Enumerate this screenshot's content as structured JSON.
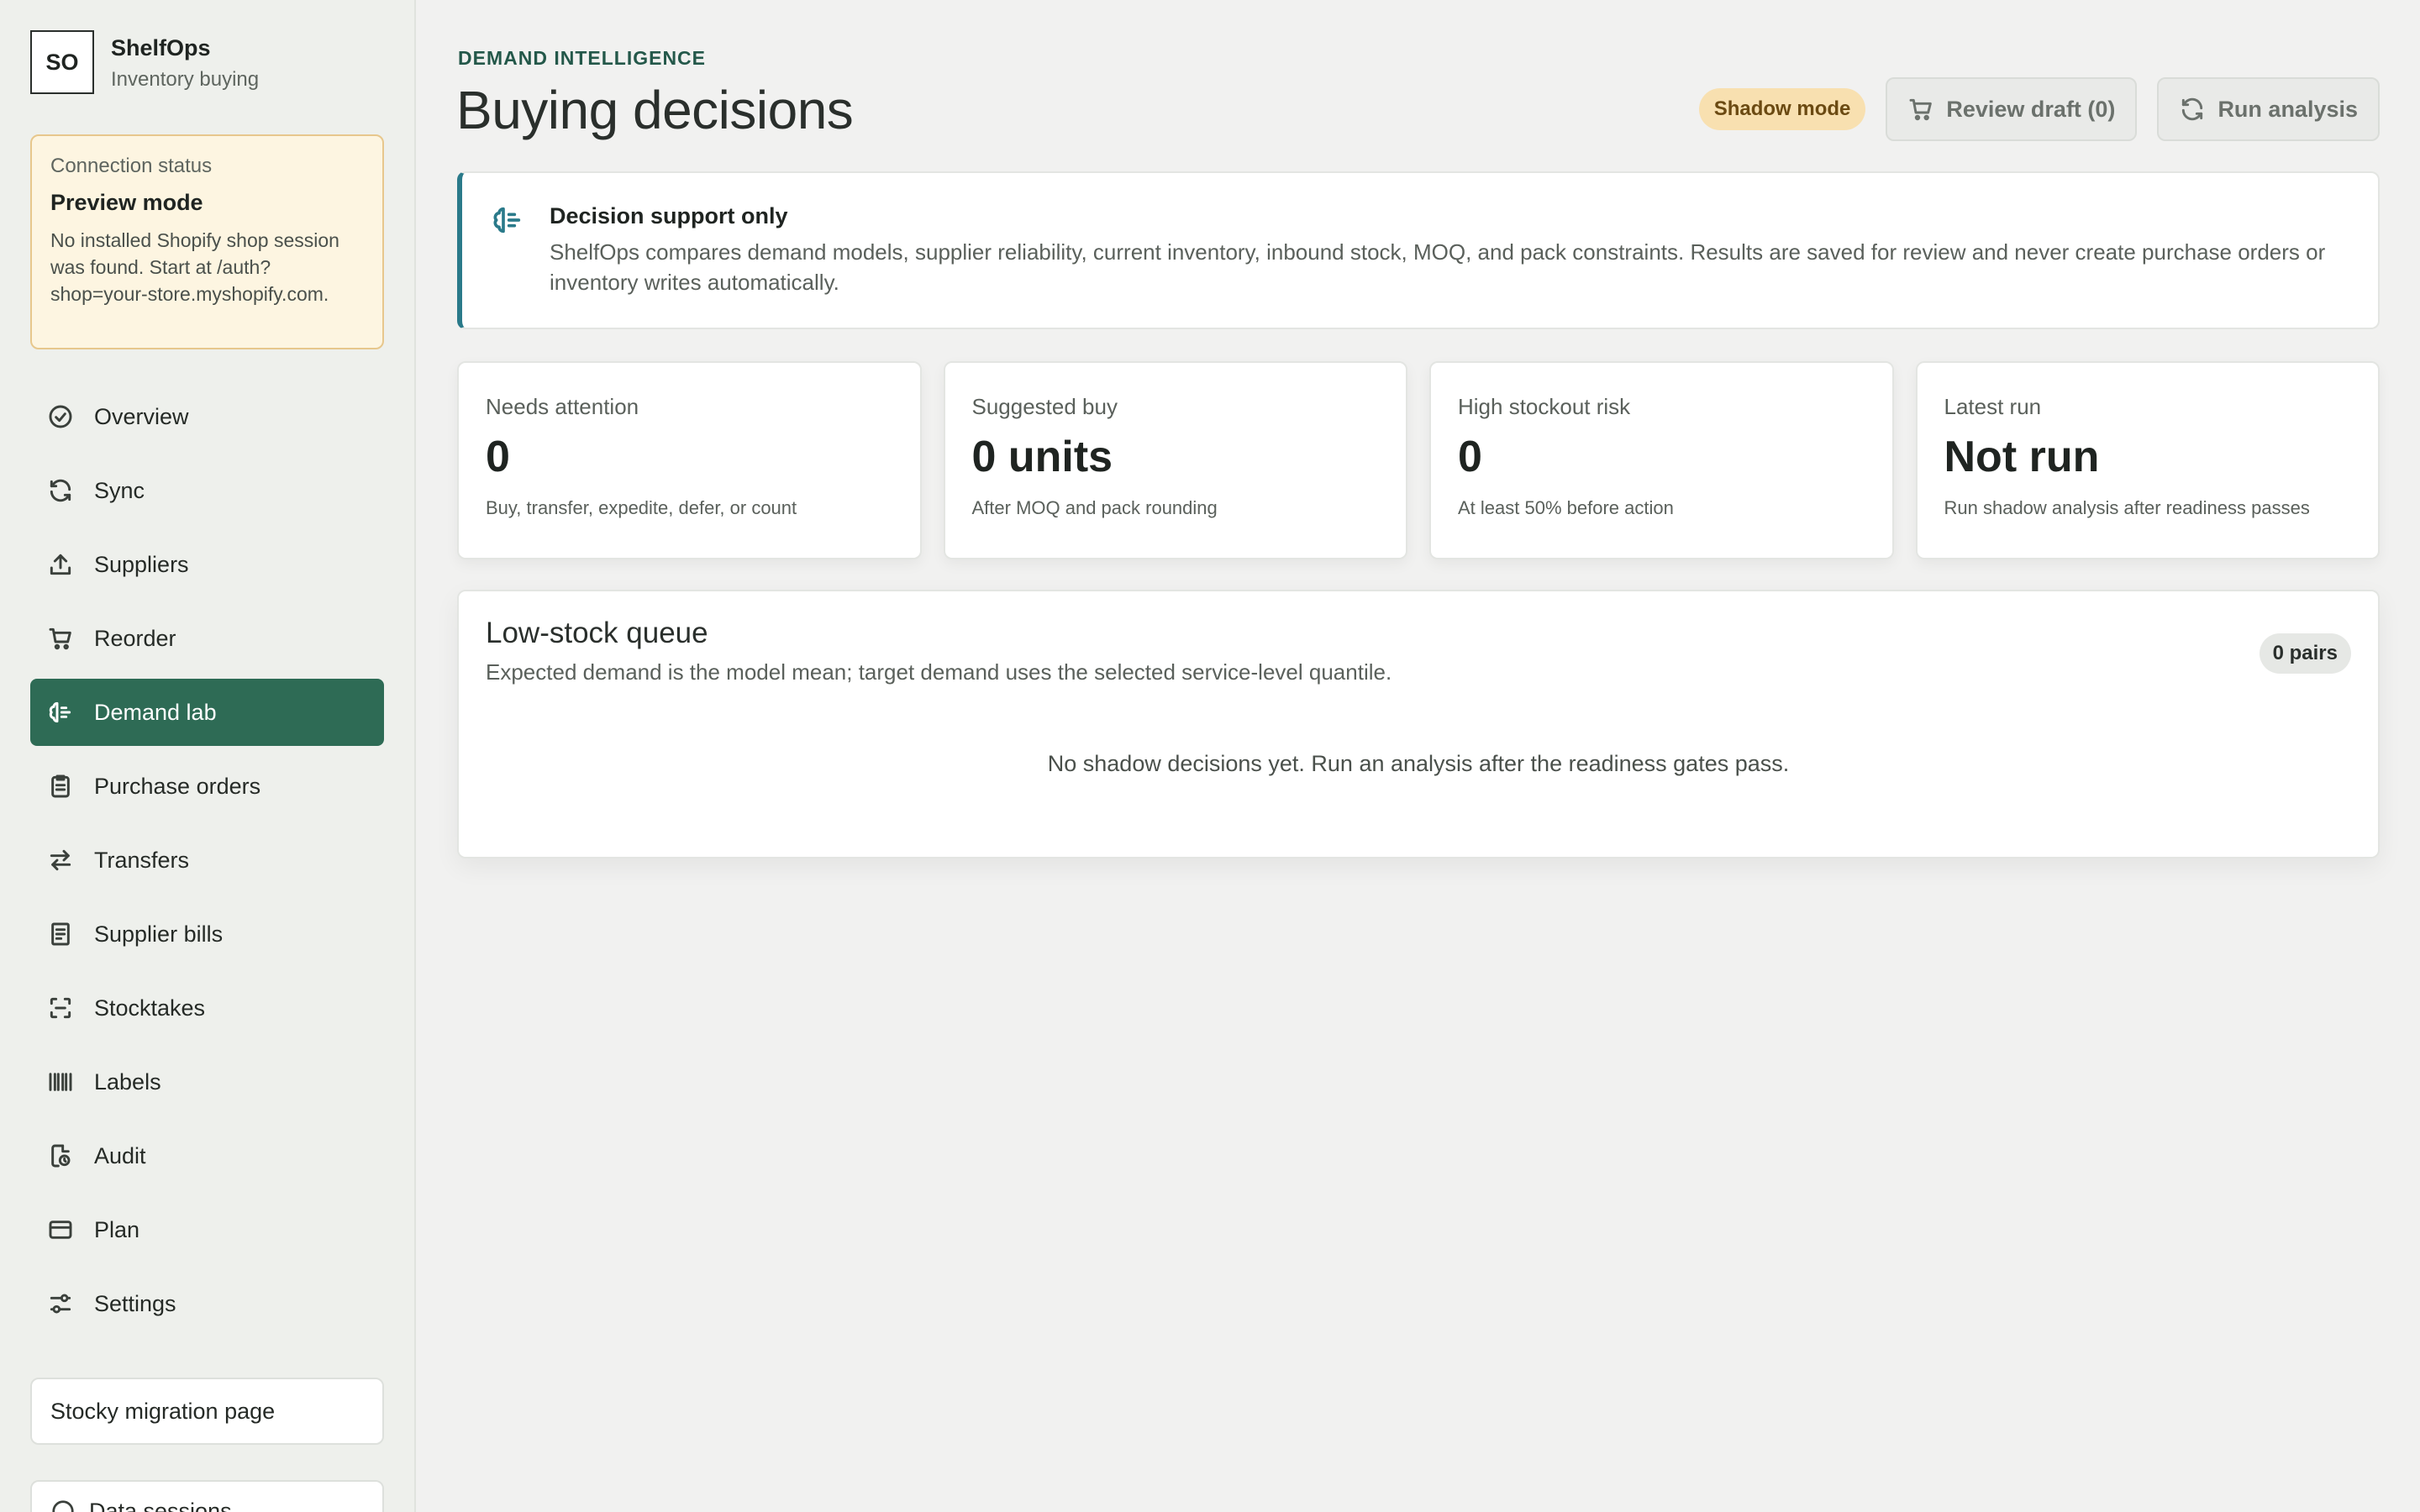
{
  "brand": {
    "logo": "SO",
    "name": "ShelfOps",
    "subtitle": "Inventory buying"
  },
  "connection": {
    "label": "Connection status",
    "title": "Preview mode",
    "body": "No installed Shopify shop session was found. Start at /auth?shop=your-store.myshopify.com."
  },
  "nav": [
    {
      "label": "Overview",
      "icon": "check-circle-icon",
      "active": false
    },
    {
      "label": "Sync",
      "icon": "refresh-icon",
      "active": false
    },
    {
      "label": "Suppliers",
      "icon": "upload-icon",
      "active": false
    },
    {
      "label": "Reorder",
      "icon": "cart-icon",
      "active": false
    },
    {
      "label": "Demand lab",
      "icon": "brain-icon",
      "active": true
    },
    {
      "label": "Purchase orders",
      "icon": "clipboard-icon",
      "active": false
    },
    {
      "label": "Transfers",
      "icon": "arrows-swap-icon",
      "active": false
    },
    {
      "label": "Supplier bills",
      "icon": "receipt-icon",
      "active": false
    },
    {
      "label": "Stocktakes",
      "icon": "scan-icon",
      "active": false
    },
    {
      "label": "Labels",
      "icon": "barcode-icon",
      "active": false
    },
    {
      "label": "Audit",
      "icon": "audit-icon",
      "active": false
    },
    {
      "label": "Plan",
      "icon": "card-icon",
      "active": false
    },
    {
      "label": "Settings",
      "icon": "sliders-icon",
      "active": false
    }
  ],
  "sidebar_footer": {
    "migration_label": "Stocky migration page",
    "next_label": "Data sessions"
  },
  "header": {
    "eyebrow": "DEMAND INTELLIGENCE",
    "title": "Buying decisions",
    "badge": "Shadow mode",
    "review_button": "Review draft (0)",
    "run_button": "Run analysis"
  },
  "notice": {
    "title": "Decision support only",
    "body": "ShelfOps compares demand models, supplier reliability, current inventory, inbound stock, MOQ, and pack constraints. Results are saved for review and never create purchase orders or inventory writes automatically."
  },
  "stats": [
    {
      "label": "Needs attention",
      "value": "0",
      "hint": "Buy, transfer, expedite, defer, or count"
    },
    {
      "label": "Suggested buy",
      "value": "0 units",
      "hint": "After MOQ and pack rounding"
    },
    {
      "label": "High stockout risk",
      "value": "0",
      "hint": "At least 50% before action"
    },
    {
      "label": "Latest run",
      "value": "Not run",
      "hint": "Run shadow analysis after readiness passes"
    }
  ],
  "queue": {
    "title": "Low-stock queue",
    "subtitle": "Expected demand is the model mean; target demand uses the selected service-level quantile.",
    "badge": "0 pairs",
    "empty": "No shadow decisions yet. Run an analysis after the readiness gates pass."
  },
  "colors": {
    "accent": "#2e6b55",
    "notice_border": "#2a7a8a",
    "badge_bg": "#f8e0b0",
    "warning_bg": "#fdf5e1"
  }
}
